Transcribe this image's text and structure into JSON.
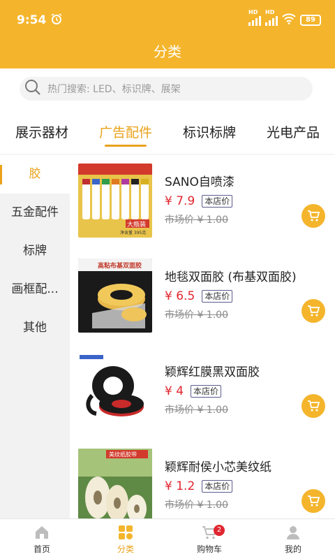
{
  "status_bar": {
    "time": "9:54",
    "battery": "89",
    "network_1": "HD",
    "network_2": "HD"
  },
  "header": {
    "title": "分类"
  },
  "search": {
    "placeholder": "热门搜索: LED、标识牌、展架"
  },
  "top_tabs": [
    {
      "label": "展示器材",
      "active": false
    },
    {
      "label": "广告配件",
      "active": true
    },
    {
      "label": "标识标牌",
      "active": false
    },
    {
      "label": "光电产品",
      "active": false
    }
  ],
  "side_categories": [
    {
      "label": "胶",
      "active": true
    },
    {
      "label": "五金配件",
      "active": false
    },
    {
      "label": "标牌",
      "active": false
    },
    {
      "label": "画框配...",
      "active": false
    },
    {
      "label": "其他",
      "active": false
    }
  ],
  "products": [
    {
      "name": "SANO自喷漆",
      "price": "¥ 7.9",
      "tag": "本店价",
      "market_price": "市场价 ¥ 1.00",
      "thumb_text": "大瓶装",
      "thumb_text_2": "净含量 395克"
    },
    {
      "name": "地毯双面胶 (布基双面胶)",
      "price": "¥ 6.5",
      "tag": "本店价",
      "market_price": "市场价 ¥ 1.00",
      "thumb_text": "高粘布基双面胶"
    },
    {
      "name": "颖辉红膜黑双面胶",
      "price": "¥ 4",
      "tag": "本店价",
      "market_price": "市场价 ¥ 1.00"
    },
    {
      "name": "颖辉耐侯小芯美纹纸",
      "price": "¥ 1.2",
      "tag": "本店价",
      "market_price": "市场价 ¥ 1.00",
      "thumb_text": "美纹纸胶带"
    }
  ],
  "tab_bar": [
    {
      "label": "首页",
      "icon": "home-icon",
      "active": false
    },
    {
      "label": "分类",
      "icon": "category-icon",
      "active": true
    },
    {
      "label": "购物车",
      "icon": "cart-icon",
      "active": false,
      "badge": "2"
    },
    {
      "label": "我的",
      "icon": "user-icon",
      "active": false
    }
  ],
  "colors": {
    "brand": "#F4B52C",
    "accent_text": "#E9A21A",
    "price": "#E0262F"
  }
}
